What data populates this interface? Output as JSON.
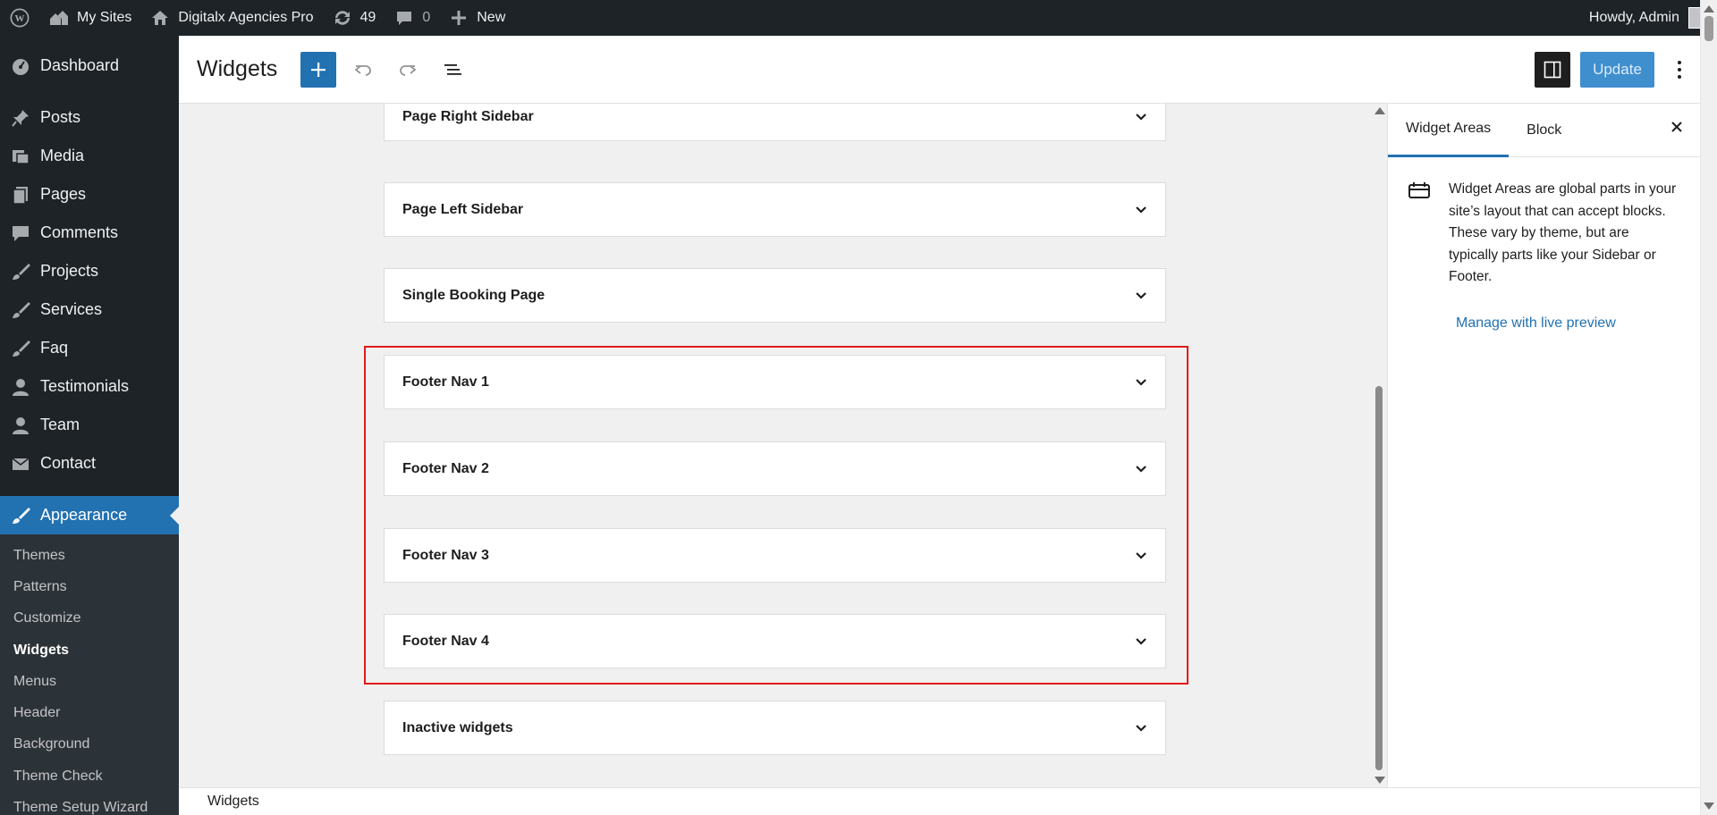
{
  "adminbar": {
    "my_sites": "My Sites",
    "site_name": "Digitalx Agencies Pro",
    "updates_count": "49",
    "comments_count": "0",
    "new_label": "New",
    "howdy": "Howdy, Admin"
  },
  "sidebar": {
    "items": [
      {
        "label": "Dashboard",
        "icon": "dashboard-icon"
      },
      {
        "label": "Posts",
        "icon": "pin-icon"
      },
      {
        "label": "Media",
        "icon": "media-icon"
      },
      {
        "label": "Pages",
        "icon": "pages-icon"
      },
      {
        "label": "Comments",
        "icon": "comment-icon"
      },
      {
        "label": "Projects",
        "icon": "brush-icon"
      },
      {
        "label": "Services",
        "icon": "brush-icon"
      },
      {
        "label": "Faq",
        "icon": "brush-icon"
      },
      {
        "label": "Testimonials",
        "icon": "user-icon"
      },
      {
        "label": "Team",
        "icon": "user-icon"
      },
      {
        "label": "Contact",
        "icon": "mail-icon"
      },
      {
        "label": "Appearance",
        "icon": "appearance-icon"
      }
    ],
    "submenu": [
      "Themes",
      "Patterns",
      "Customize",
      "Widgets",
      "Menus",
      "Header",
      "Background",
      "Theme Check",
      "Theme Setup Wizard"
    ]
  },
  "header": {
    "title": "Widgets",
    "update_label": "Update"
  },
  "widget_areas": [
    "Page Right Sidebar",
    "Page Left Sidebar",
    "Single Booking Page",
    "Footer Nav 1",
    "Footer Nav 2",
    "Footer Nav 3",
    "Footer Nav 4",
    "Inactive widgets"
  ],
  "panel": {
    "tab_widget_areas": "Widget Areas",
    "tab_block": "Block",
    "description": "Widget Areas are global parts in your site’s layout that can accept blocks. These vary by theme, but are typically parts like your Sidebar or Footer.",
    "live_preview": "Manage with live preview"
  },
  "footer": {
    "breadcrumb": "Widgets"
  },
  "colors": {
    "accent": "#2271b1",
    "adminbar": "#1d2327",
    "highlight": "#e11a1a"
  }
}
